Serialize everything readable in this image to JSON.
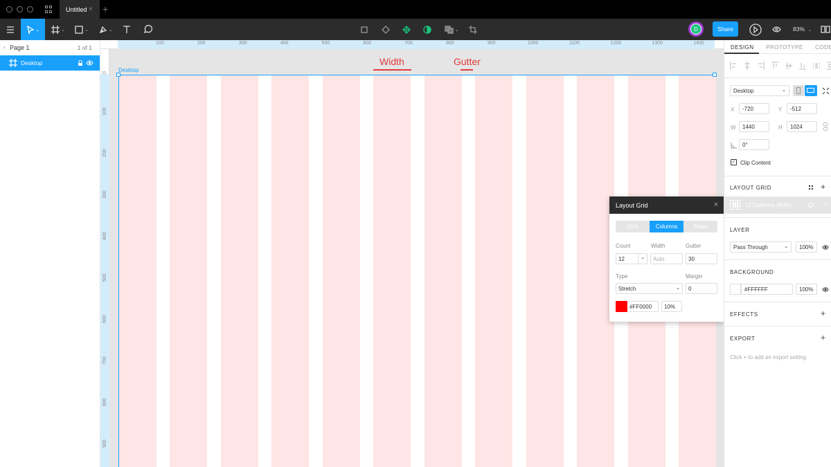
{
  "titlebar": {
    "tab_title": "Untitled",
    "tab_close": "×",
    "new_tab": "+"
  },
  "toolbar": {
    "share_label": "Share",
    "avatar_initial": "D",
    "zoom": "83%",
    "zoom_caret": "⌄",
    "tool_caret": "⌄"
  },
  "left_panel": {
    "page_name": "Page 1",
    "page_count": "1 of 1",
    "layer_name": "Desktop",
    "page_chevron": "‹"
  },
  "rulers": {
    "top_ticks": [
      "100",
      "200",
      "300",
      "400",
      "500",
      "600",
      "700",
      "800",
      "900",
      "1000",
      "1100",
      "1200",
      "1300",
      "1400"
    ],
    "left_ticks": [
      "0",
      "100",
      "200",
      "300",
      "400",
      "500",
      "600",
      "700",
      "800",
      "900"
    ]
  },
  "canvas": {
    "frame_label": "Desktop",
    "column_count": 12,
    "annotations": {
      "width": "Width",
      "gutter": "Gutter"
    },
    "colors": {
      "column_fill": "#FFE5E5",
      "annotation": "#E03A3A",
      "selection": "#18A0FB"
    }
  },
  "layout_grid_popup": {
    "title": "Layout Grid",
    "close": "×",
    "tabs": [
      "Grid",
      "Columns",
      "Rows"
    ],
    "active_tab": "Columns",
    "count_label": "Count",
    "count_value": "12",
    "width_label": "Width",
    "width_placeholder": "Auto",
    "gutter_label": "Gutter",
    "gutter_value": "30",
    "type_label": "Type",
    "type_value": "Stretch",
    "margin_label": "Margin",
    "margin_value": "0",
    "color_value": "#FF0000",
    "opacity_value": "10%",
    "select_caret": "⌄"
  },
  "right_panel": {
    "tabs": [
      "DESIGN",
      "PROTOTYPE",
      "CODE"
    ],
    "active_tab": "DESIGN",
    "frame_preset": "Desktop",
    "x_label": "X",
    "x_value": "-720",
    "y_label": "Y",
    "y_value": "-512",
    "w_label": "W",
    "w_value": "1440",
    "h_label": "H",
    "h_value": "1024",
    "rotation_value": "0°",
    "clip_content_label": "Clip Content",
    "layout_grid_title": "LAYOUT GRID",
    "grid_item_label": "12 Columns (Auto)",
    "layer_title": "LAYER",
    "blend_mode": "Pass Through",
    "layer_opacity": "100%",
    "background_title": "BACKGROUND",
    "background_color": "#FFFFFF",
    "background_opacity": "100%",
    "effects_title": "EFFECTS",
    "export_title": "EXPORT",
    "export_hint": "Click + to add an export setting",
    "plus": "+",
    "minus": "−",
    "select_caret": "⌄"
  }
}
